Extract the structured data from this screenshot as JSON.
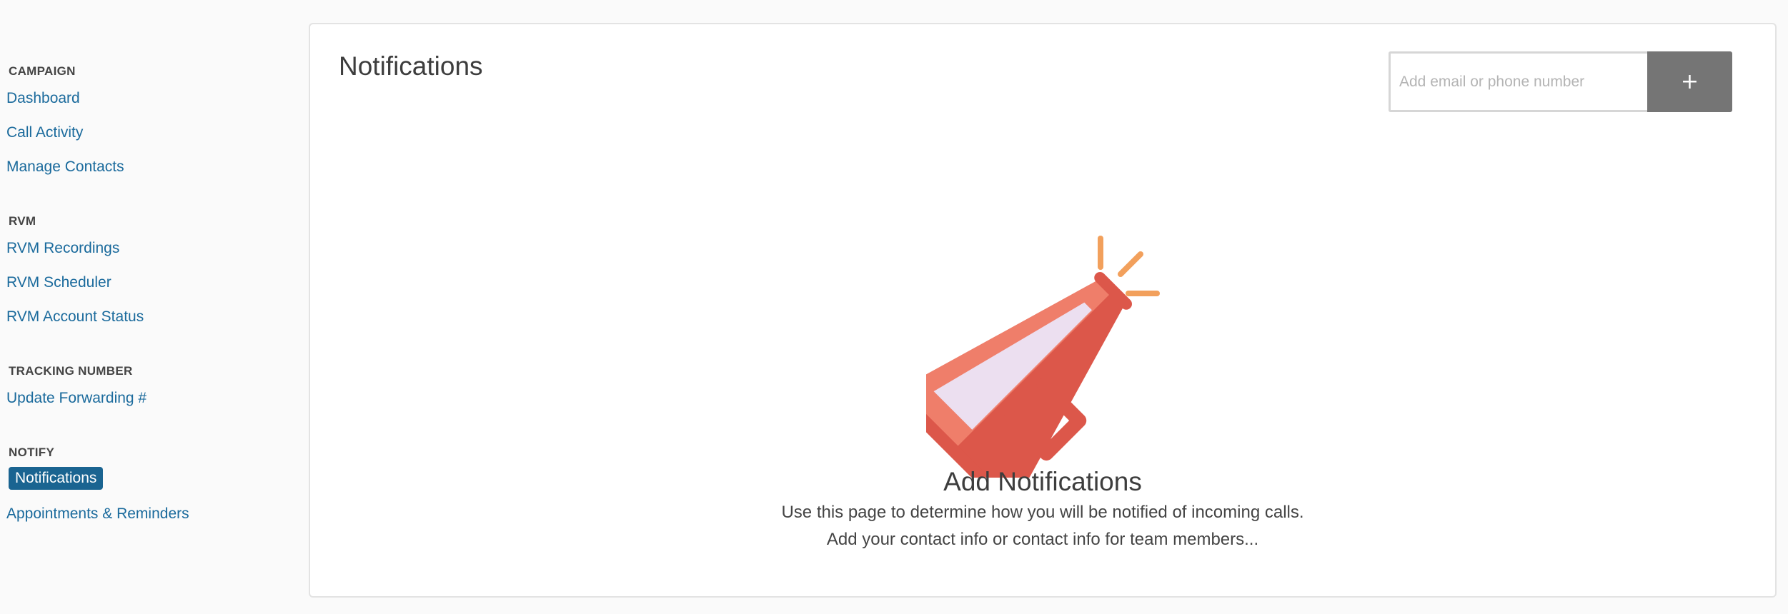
{
  "sidebar": {
    "sections": [
      {
        "title": "CAMPAIGN",
        "items": [
          {
            "label": "Dashboard"
          },
          {
            "label": "Call Activity"
          },
          {
            "label": "Manage Contacts"
          }
        ]
      },
      {
        "title": "RVM",
        "items": [
          {
            "label": "RVM Recordings"
          },
          {
            "label": "RVM Scheduler"
          },
          {
            "label": "RVM Account Status"
          }
        ]
      },
      {
        "title": "TRACKING NUMBER",
        "items": [
          {
            "label": "Update Forwarding #"
          }
        ]
      },
      {
        "title": "NOTIFY",
        "items": [
          {
            "label": "Notifications",
            "active": true
          },
          {
            "label": "Appointments & Reminders"
          }
        ]
      }
    ]
  },
  "main": {
    "title": "Notifications",
    "contact_input": {
      "placeholder": "Add email or phone number",
      "value": ""
    },
    "add_button": {
      "label": "+"
    },
    "empty_state": {
      "icon": "megaphone-icon",
      "title": "Add Notifications",
      "line1": "Use this page to determine how you will be notified of incoming calls.",
      "line2": "Add your contact info or contact info for team members..."
    }
  },
  "colors": {
    "link": "#1a6a9c",
    "active_nav_bg": "#1a6491",
    "add_button_bg": "#757575",
    "megaphone_red": "#dc574a",
    "megaphone_light": "#ef7e6a",
    "sound_lines": "#f2a05c"
  }
}
